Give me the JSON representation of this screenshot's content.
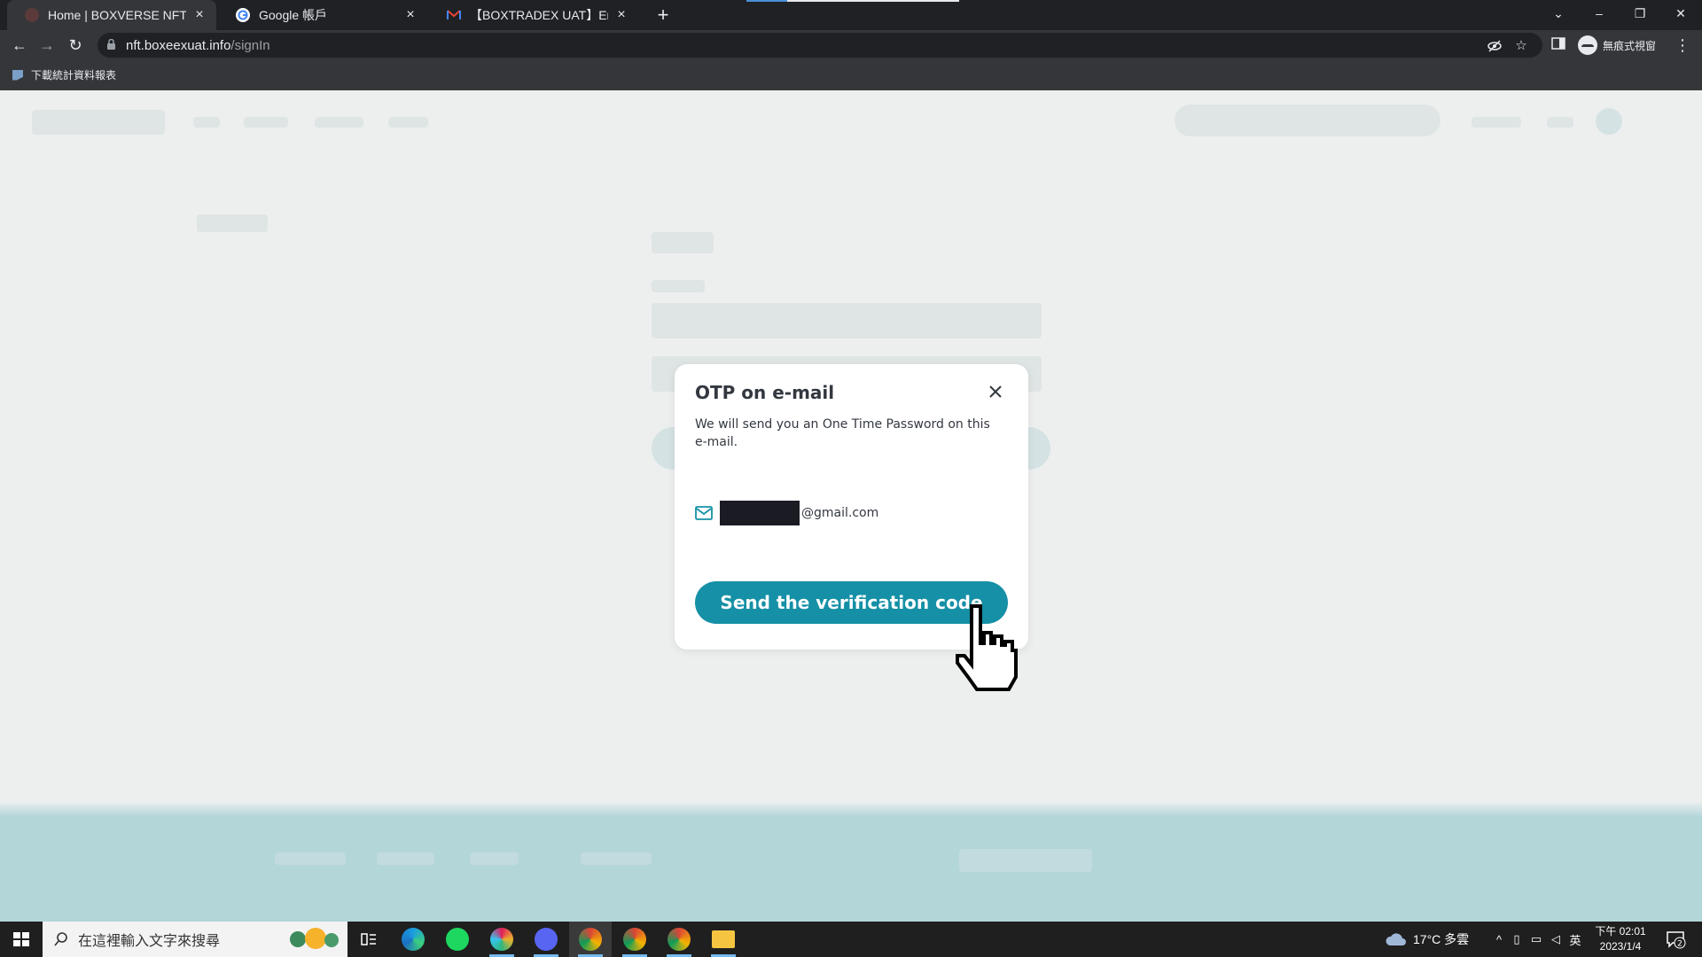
{
  "browser": {
    "tabs": [
      {
        "title": "Home | BOXVERSE NFT Market",
        "active": true
      },
      {
        "title": "Google 帳戶",
        "active": false
      },
      {
        "title": "【BOXTRADEX UAT】Email veri",
        "active": false
      }
    ],
    "url_host": "nft.boxeexuat.info",
    "url_path": "/signIn",
    "profile_label": "無痕式視窗",
    "bookmark": "下載統計資料報表",
    "new_tab_symbol": "+",
    "min_symbol": "–",
    "restore_symbol": "❐",
    "close_symbol": "✕",
    "chevron_symbol": "⌄",
    "tab_close_symbol": "×",
    "back_symbol": "←",
    "forward_symbol": "→",
    "reload_symbol": "↻",
    "star_symbol": "☆",
    "menu_symbol": "⋮"
  },
  "modal": {
    "title": "OTP on e-mail",
    "description": "We will send you an One Time Password on this e-mail.",
    "email_domain": "@gmail.com",
    "send_button": "Send the verification code"
  },
  "taskbar": {
    "search_placeholder": "在這裡輸入文字來搜尋",
    "weather": "17°C 多雲",
    "ime": "英",
    "time": "下午 02:01",
    "date": "2023/1/4",
    "notification_count": "2"
  },
  "colors": {
    "accent": "#1590a6",
    "footer": "#7ec7cf",
    "chrome_dark": "#202124",
    "chrome_mid": "#35363a"
  }
}
